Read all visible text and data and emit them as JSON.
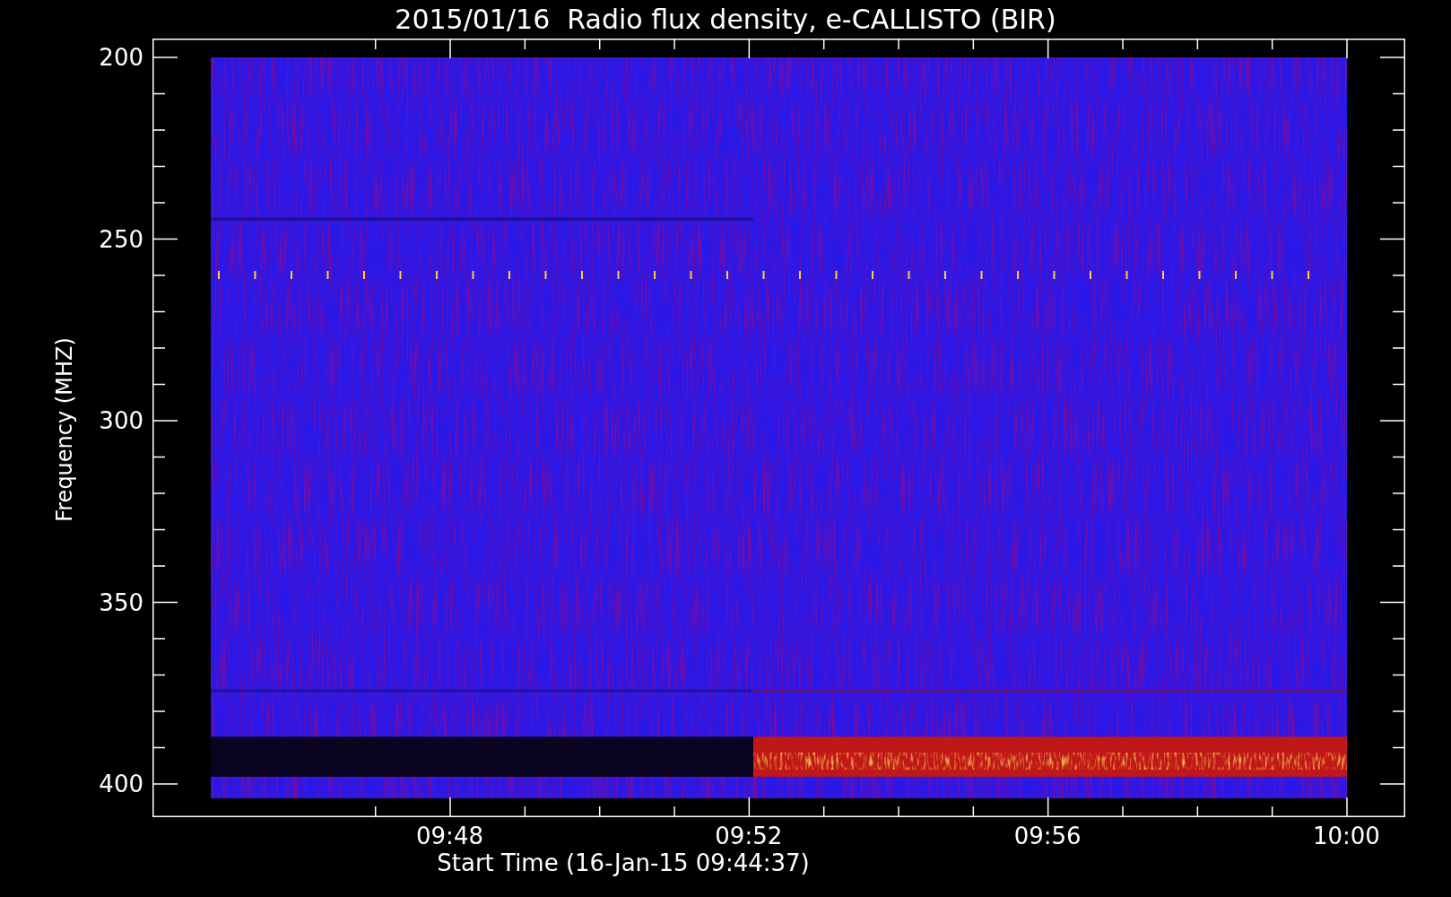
{
  "plot": {
    "title": "2015/01/16  Radio flux density, e-CALLISTO (BIR)",
    "ylabel": "Frequency (MHZ)",
    "yticks": [
      "200",
      "250",
      "300",
      "350",
      "400"
    ],
    "xticks": [
      "09:48",
      "09:52",
      "09:56",
      "10:00"
    ],
    "xlabel": "Start Time (16-Jan-15 09:44:37)"
  }
}
